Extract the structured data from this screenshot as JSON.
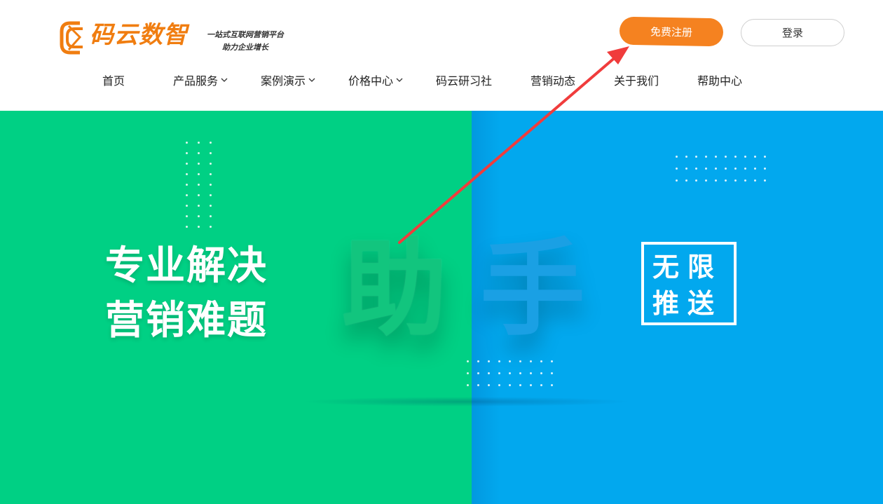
{
  "brand": {
    "name": "码云数智",
    "slogan_line1": "一站式互联网营销平台",
    "slogan_line2": "助力企业增长",
    "color": "#f07d10"
  },
  "header": {
    "register_label": "免费注册",
    "login_label": "登录"
  },
  "nav": {
    "items": [
      {
        "label": "首页",
        "has_dropdown": false
      },
      {
        "label": "产品服务",
        "has_dropdown": true
      },
      {
        "label": "案例演示",
        "has_dropdown": true
      },
      {
        "label": "价格中心",
        "has_dropdown": true
      },
      {
        "label": "码云研习社",
        "has_dropdown": false
      },
      {
        "label": "营销动态",
        "has_dropdown": false
      },
      {
        "label": "关于我们",
        "has_dropdown": false
      },
      {
        "label": "帮助中心",
        "has_dropdown": false
      }
    ]
  },
  "hero": {
    "headline_line1": "专业解决",
    "headline_line2": "营销难题",
    "big_char_1": "助",
    "big_char_2": "手",
    "badge_line1": "无限",
    "badge_line2": "推送",
    "left_color": "#00d084",
    "right_color": "#02a8ee"
  },
  "annotation": {
    "arrow_color": "#f03c3c"
  }
}
